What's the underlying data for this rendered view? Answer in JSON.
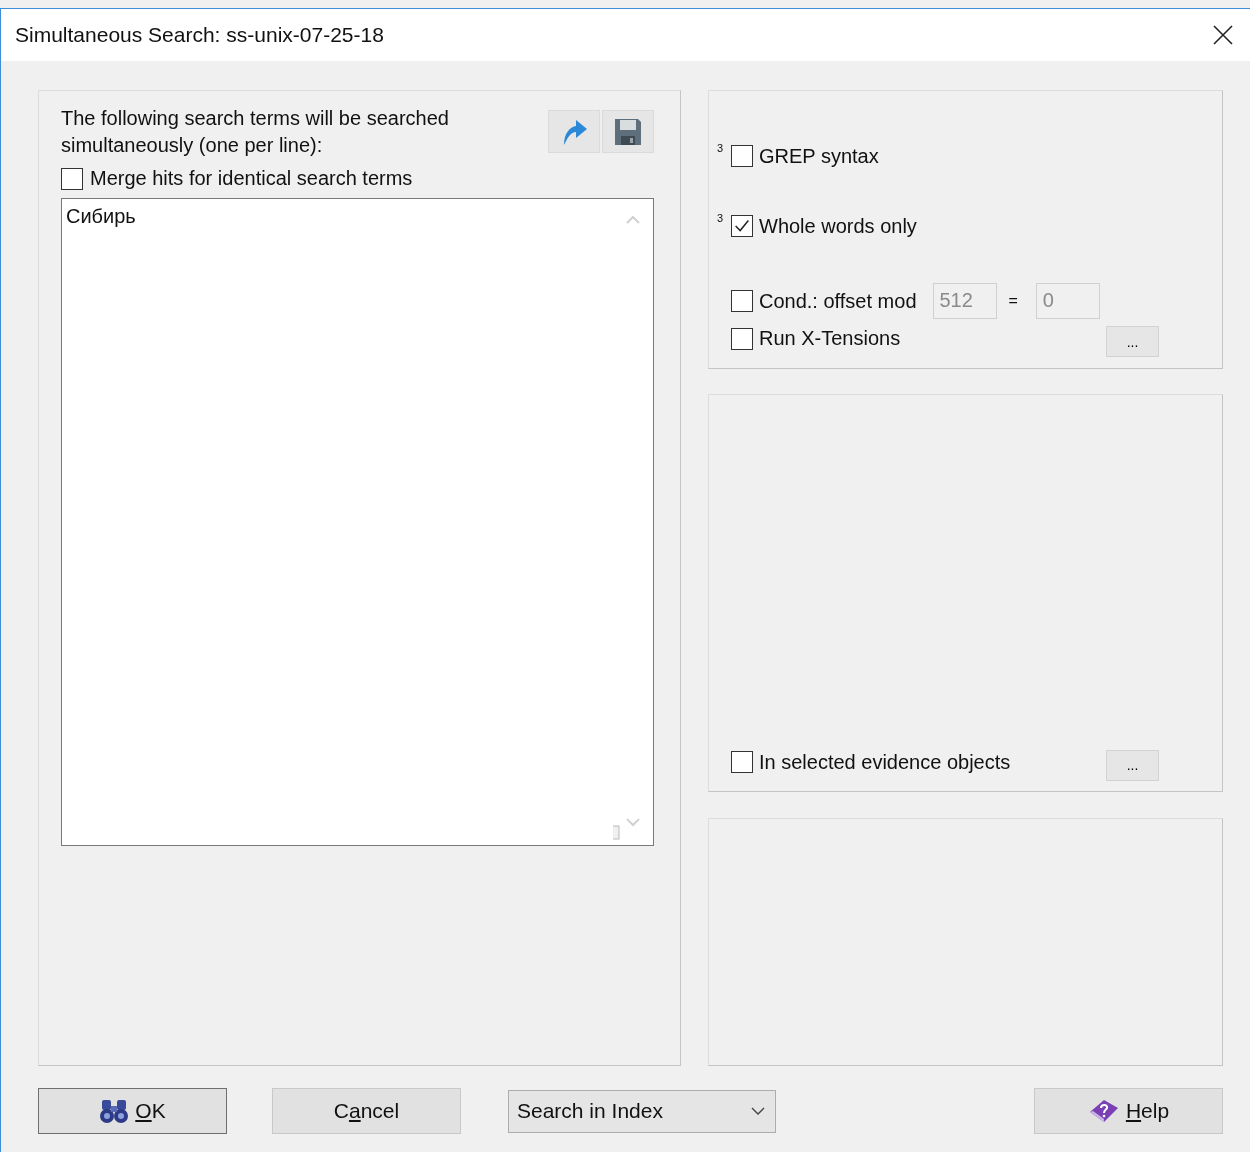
{
  "window": {
    "title": "Simultaneous Search: ss-unix-07-25-18"
  },
  "terms_panel": {
    "instructions": "The following search terms will be searched simultaneously (one per line):",
    "merge_hits": {
      "label": "Merge hits for identical search terms",
      "checked": false
    },
    "terms": "Сибирь"
  },
  "options": [
    {
      "kind": "checkbox",
      "note": "3",
      "label": "GREP syntax",
      "checked": false
    },
    {
      "kind": "checkbox",
      "note": "3",
      "label": "Whole words only",
      "checked": true
    },
    {
      "kind": "condition",
      "label": "Cond.: offset mod",
      "checked": false,
      "modulus": {
        "value": "512",
        "disabled": true
      },
      "equals": "=",
      "remainder": {
        "value": "0",
        "disabled": true
      }
    },
    {
      "kind": "button_row",
      "label": "Run X-Tensions",
      "checked": false,
      "button": "..."
    }
  ],
  "evidence_option": {
    "label": "In selected evidence objects",
    "checked": false,
    "button": "..."
  },
  "footer": {
    "ok": {
      "key": "O",
      "rest": "K",
      "default": true
    },
    "cancel": {
      "lead": "C",
      "key": "a",
      "rest": "ncel",
      "default": false
    },
    "search_mode": "Search in Index",
    "help": {
      "key": "H",
      "rest": "elp",
      "default": false
    }
  }
}
